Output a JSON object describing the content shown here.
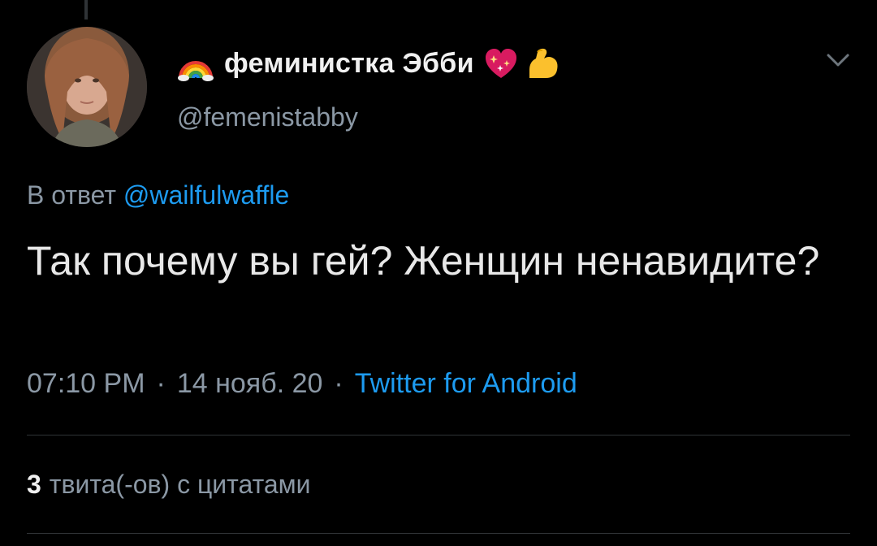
{
  "tweet": {
    "author": {
      "display_name": "феминистка Эбби",
      "handle": "@femenistabby",
      "name_emojis": [
        "rainbow-icon",
        "sparkling-heart-icon",
        "flexed-biceps-icon"
      ]
    },
    "reply_to": {
      "prefix": "В ответ",
      "mention": "@wailfulwaffle"
    },
    "text": "Так почему вы гей? Женщин ненавидите?",
    "meta": {
      "time": "07:10 PM",
      "separator": "·",
      "date": "14 нояб. 20",
      "source": "Twitter for Android"
    },
    "quotes": {
      "count": "3",
      "label": "твита(-ов) с цитатами"
    }
  },
  "colors": {
    "background": "#000000",
    "primary_text": "#e8e8e8",
    "secondary_text": "#8b98a5",
    "link": "#1d9bf0",
    "divider": "#2f3336"
  },
  "icons": {
    "menu": "chevron-down-icon"
  }
}
